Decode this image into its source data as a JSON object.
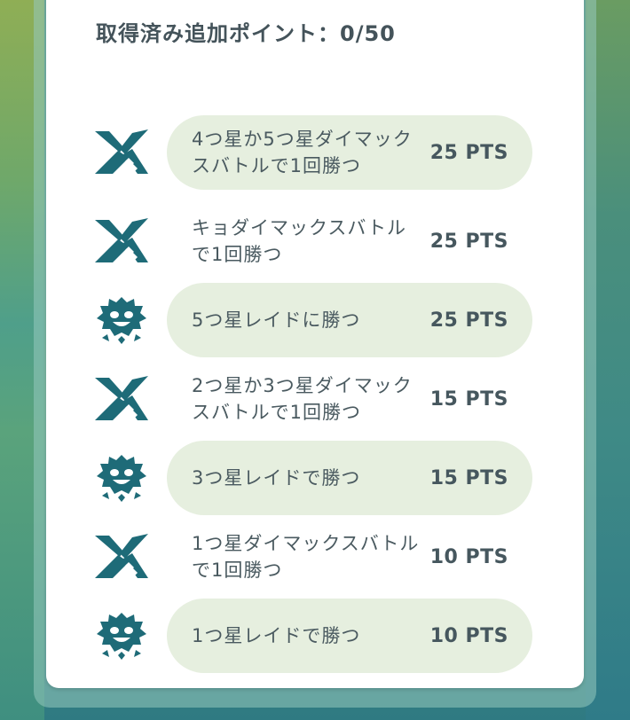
{
  "header": {
    "earned_points": "取得済み追加ポイント：0/50"
  },
  "tasks": [
    {
      "icon": "max-battle-icon",
      "label": "4つ星か5つ星ダイマックスバトルで1回勝つ",
      "points": "25 PTS"
    },
    {
      "icon": "max-battle-icon",
      "label": "キョダイマックスバトルで1回勝つ",
      "points": "25 PTS"
    },
    {
      "icon": "raid-boss-icon",
      "label": "5つ星レイドに勝つ",
      "points": "25 PTS"
    },
    {
      "icon": "max-battle-icon",
      "label": "2つ星か3つ星ダイマックスバトルで1回勝つ",
      "points": "15 PTS"
    },
    {
      "icon": "raid-boss-icon",
      "label": "3つ星レイドで勝つ",
      "points": "15 PTS"
    },
    {
      "icon": "max-battle-icon",
      "label": "1つ星ダイマックスバトルで1回勝つ",
      "points": "10 PTS"
    },
    {
      "icon": "raid-boss-icon",
      "label": "1つ星レイドで勝つ",
      "points": "10 PTS"
    }
  ],
  "colors": {
    "icon": "#1e6b78",
    "pill": "#e6efdf",
    "text": "#4a5a60",
    "points": "#46575e"
  }
}
